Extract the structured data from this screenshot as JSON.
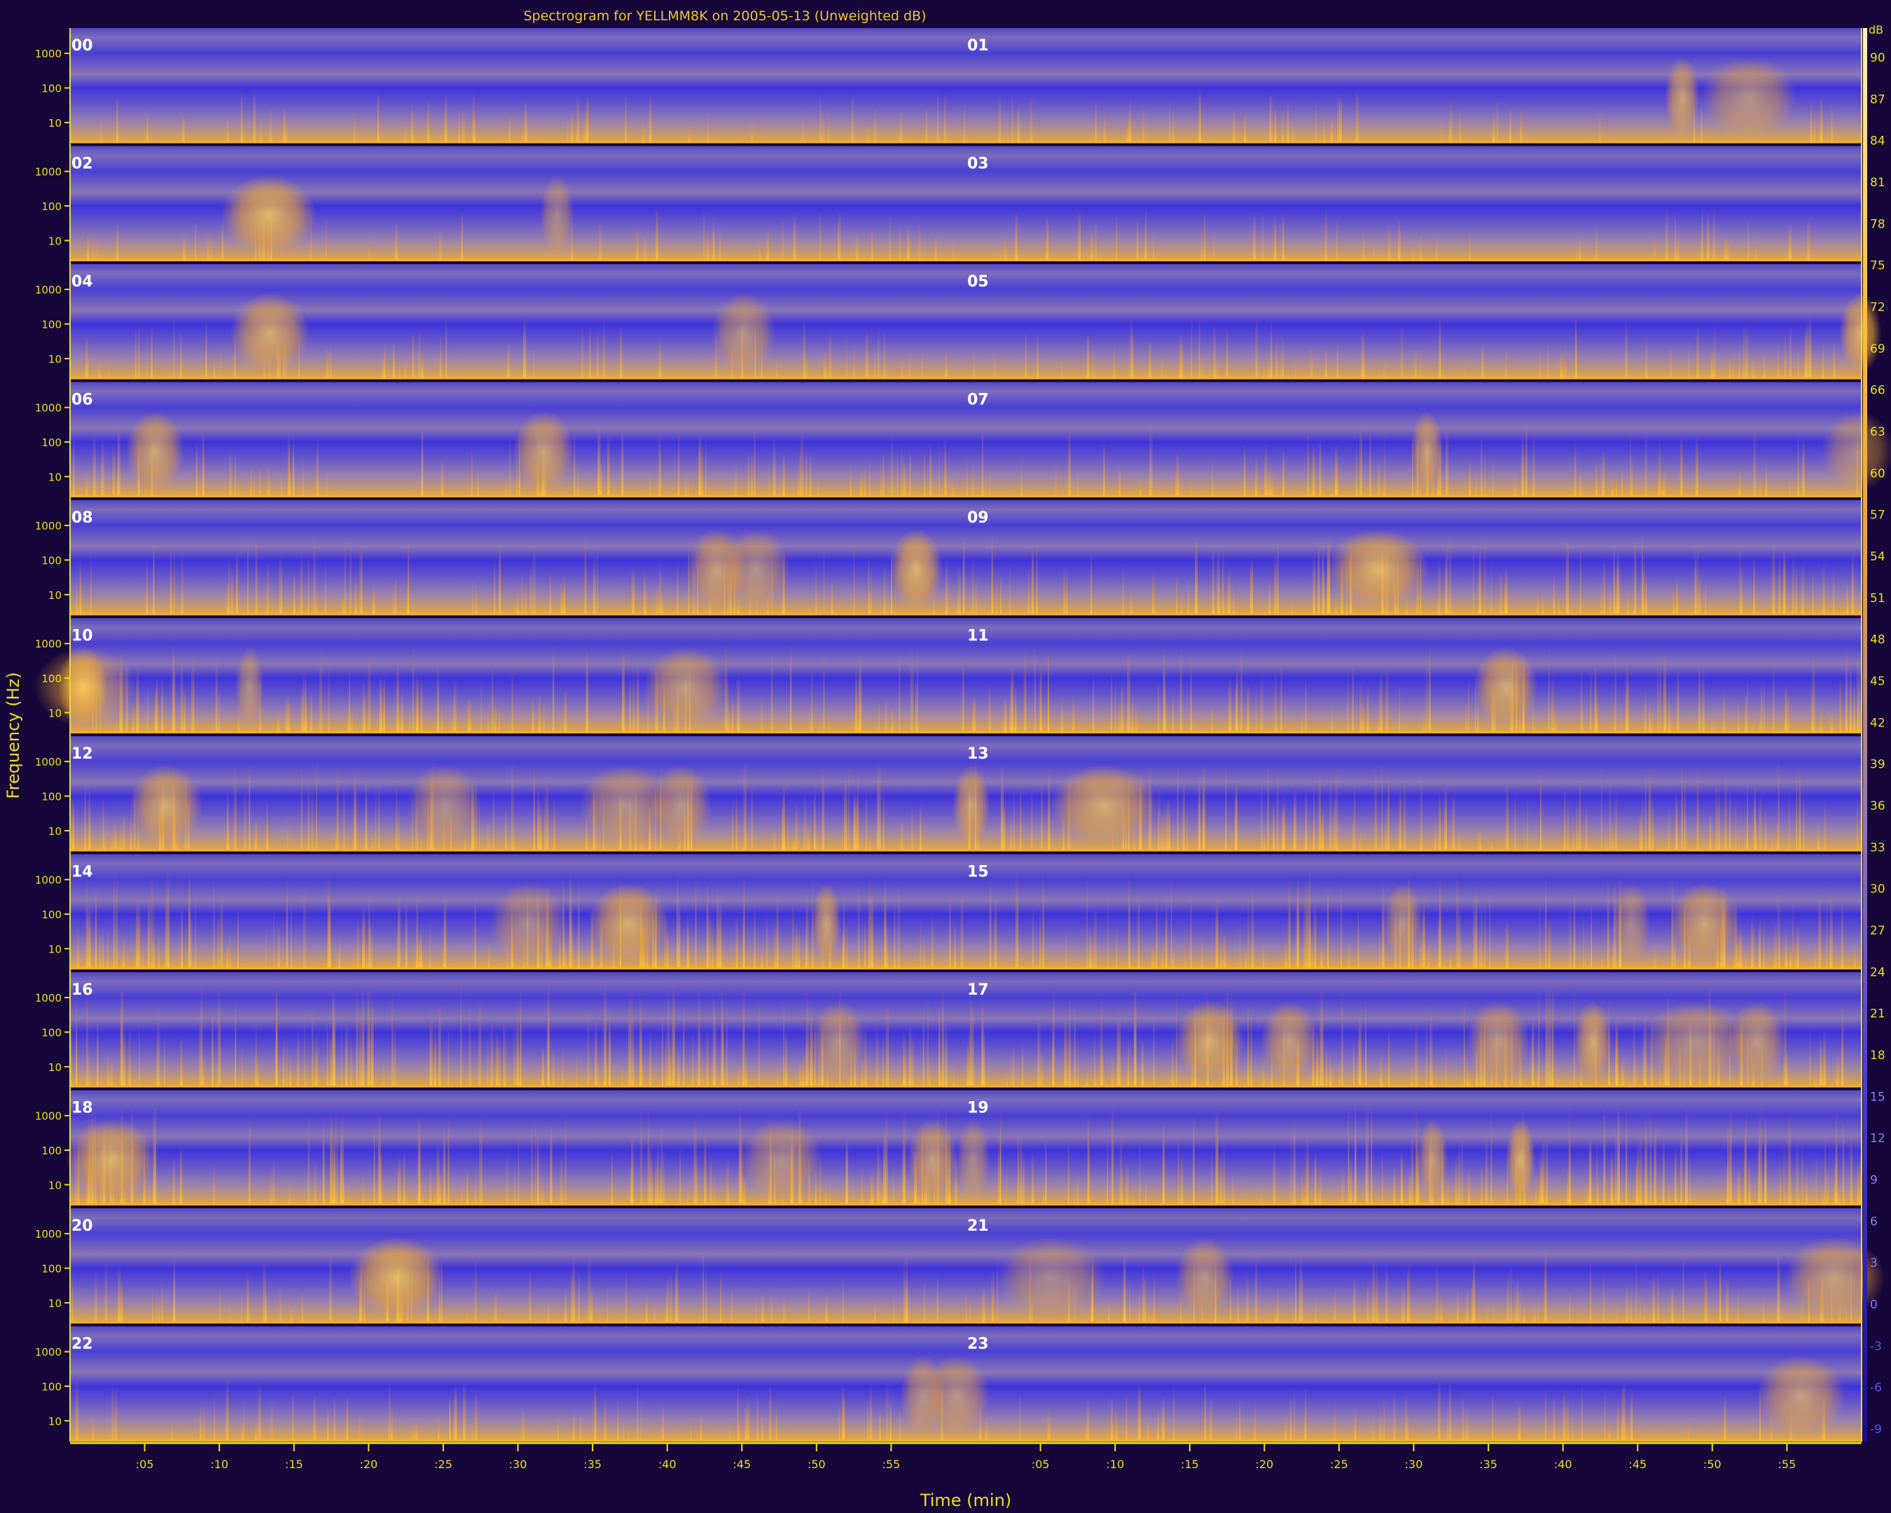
{
  "chart_data": {
    "type": "heatmap",
    "title": "Spectrogram for YELLMM8K on 2005-05-13 (Unweighted dB)",
    "xlabel": "Time (min)",
    "ylabel": "Frequency (Hz)",
    "yticks": [
      "1000",
      "100",
      "10"
    ],
    "xtick_labels": [
      ":05",
      ":10",
      ":15",
      ":20",
      ":25",
      ":30",
      ":35",
      ":40",
      ":45",
      ":50",
      ":55"
    ],
    "xlim_minutes": [
      0,
      60
    ],
    "rows": [
      {
        "left_hour": "00",
        "right_hour": "01"
      },
      {
        "left_hour": "02",
        "right_hour": "03"
      },
      {
        "left_hour": "04",
        "right_hour": "05"
      },
      {
        "left_hour": "06",
        "right_hour": "07"
      },
      {
        "left_hour": "08",
        "right_hour": "09"
      },
      {
        "left_hour": "10",
        "right_hour": "11"
      },
      {
        "left_hour": "12",
        "right_hour": "13"
      },
      {
        "left_hour": "14",
        "right_hour": "15"
      },
      {
        "left_hour": "16",
        "right_hour": "17"
      },
      {
        "left_hour": "18",
        "right_hour": "19"
      },
      {
        "left_hour": "20",
        "right_hour": "21"
      },
      {
        "left_hour": "22",
        "right_hour": "23"
      }
    ],
    "colorbar": {
      "unit": "dB",
      "range": [
        -9,
        90
      ],
      "tick_labels": [
        "90",
        "87",
        "84",
        "81",
        "78",
        "75",
        "72",
        "69",
        "66",
        "63",
        "60",
        "57",
        "54",
        "51",
        "48",
        "45",
        "42",
        "39",
        "36",
        "33",
        "30",
        "27",
        "24",
        "21",
        "18",
        "15",
        "12",
        "9",
        "6",
        "3",
        "0",
        "-3",
        "-6",
        "-9"
      ]
    },
    "colors": {
      "background": "#16063a",
      "low": "#3c2fd8",
      "mid": "#9a78b8",
      "high": "#ffb21a",
      "peak": "#fff0c0",
      "axis": "#e8e020",
      "title_text": "#f0c828"
    }
  }
}
